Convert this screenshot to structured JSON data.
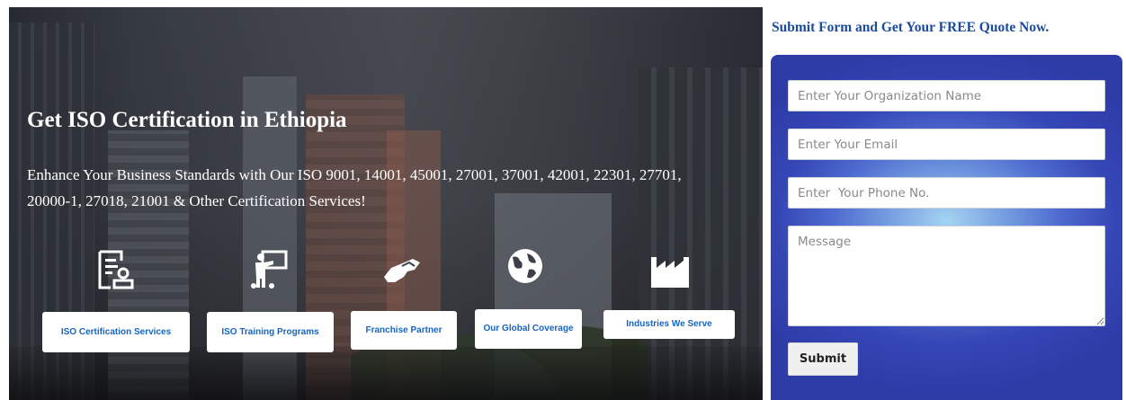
{
  "hero": {
    "title": "Get ISO Certification in Ethiopia",
    "subtitle": "Enhance Your Business Standards with Our ISO 9001, 14001, 45001, 27001, 37001, 42001, 22301, 27701, 20000-1, 27018, 21001 & Other Certification Services!"
  },
  "services": [
    {
      "label": "ISO Certification Services",
      "icon": "certificate-icon"
    },
    {
      "label": "ISO Training Programs",
      "icon": "training-presenter-icon"
    },
    {
      "label": "Franchise Partner",
      "icon": "handshake-icon"
    },
    {
      "label": "Our Global Coverage",
      "icon": "globe-icon"
    },
    {
      "label": "Industries We Serve",
      "icon": "factory-icon"
    }
  ],
  "form": {
    "title": "Submit Form and Get Your FREE Quote Now.",
    "org_placeholder": "Enter Your Organization Name",
    "email_placeholder": "Enter Your Email",
    "phone_placeholder": "Enter  Your Phone No.",
    "message_placeholder": "Message",
    "submit_label": "Submit"
  },
  "colors": {
    "accent": "#1565c0",
    "form_title": "#1a4b9c",
    "panel": "#3546b5"
  }
}
